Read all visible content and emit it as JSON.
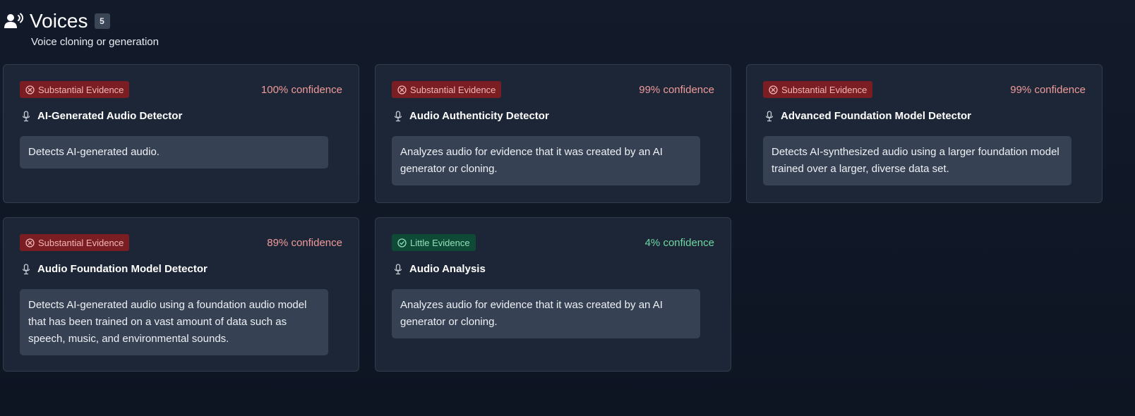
{
  "header": {
    "icon": "voice-icon",
    "title": "Voices",
    "count": "5",
    "subtitle": "Voice cloning or generation"
  },
  "colors": {
    "substantial_badge_bg": "#7a1e23",
    "substantial_text": "#f09a9a",
    "little_badge_bg": "#0f4a37",
    "little_text": "#6fd6a3",
    "card_bg": "#1c2636",
    "desc_bg": "#364254"
  },
  "cards": [
    {
      "badge": "Substantial Evidence",
      "badge_icon": "x-circle-icon",
      "confidence": "100% confidence",
      "title_icon": "microphone-icon",
      "title": "AI-Generated Audio Detector",
      "description": "Detects AI-generated audio."
    },
    {
      "badge": "Substantial Evidence",
      "badge_icon": "x-circle-icon",
      "confidence": "99% confidence",
      "title_icon": "microphone-icon",
      "title": "Audio Authenticity Detector",
      "description": "Analyzes audio for evidence that it was created by an AI generator or cloning."
    },
    {
      "badge": "Substantial Evidence",
      "badge_icon": "x-circle-icon",
      "confidence": "99% confidence",
      "title_icon": "microphone-icon",
      "title": "Advanced Foundation Model Detector",
      "description": "Detects AI-synthesized audio using a larger foundation model trained over a larger, diverse data set."
    },
    {
      "badge": "Substantial Evidence",
      "badge_icon": "x-circle-icon",
      "confidence": "89% confidence",
      "title_icon": "microphone-icon",
      "title": "Audio Foundation Model Detector",
      "description": "Detects AI-generated audio using a foundation audio model that has been trained on a vast amount of data such as speech, music, and environmental sounds."
    },
    {
      "badge": "Little Evidence",
      "badge_icon": "check-circle-icon",
      "confidence": "4% confidence",
      "title_icon": "microphone-icon",
      "title": "Audio Analysis",
      "description": "Analyzes audio for evidence that it was created by an AI generator or cloning."
    }
  ]
}
